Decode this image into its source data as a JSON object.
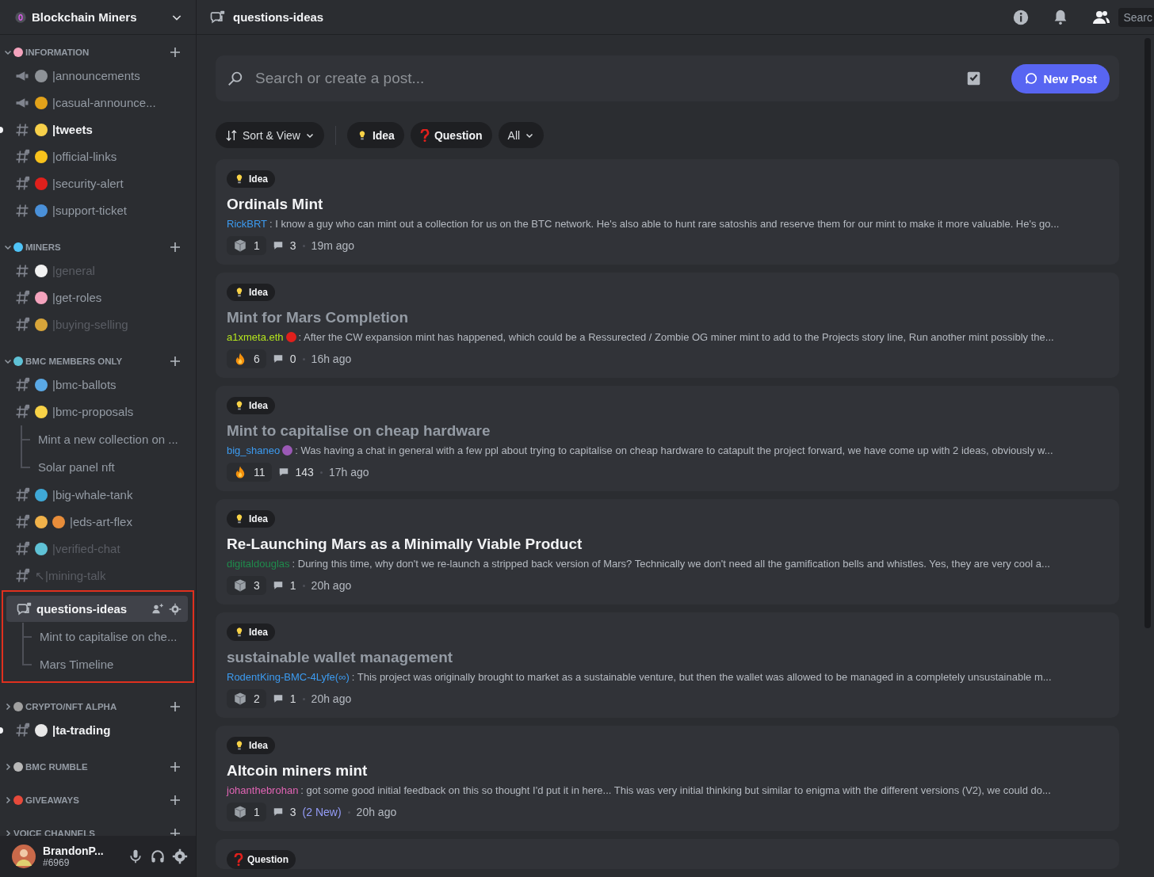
{
  "server": {
    "name": "Blockchain Miners"
  },
  "categories": [
    {
      "name": "INFORMATION",
      "emojis": [
        {
          "color": "#f4a3bd"
        }
      ],
      "expanded": true,
      "items": [
        {
          "kind": "announce",
          "emojis": [
            {
              "color": "#8e9297"
            }
          ],
          "label": "|announcements",
          "unread": false,
          "muted": false,
          "selected": false
        },
        {
          "kind": "announce",
          "emojis": [
            {
              "color": "#e2a21a"
            }
          ],
          "label": "|casual-announce...",
          "unread": false,
          "muted": false,
          "selected": false
        },
        {
          "kind": "text",
          "emojis": [
            {
              "color": "#f7d04a"
            }
          ],
          "label": "|tweets",
          "unread": true,
          "muted": false,
          "selected": false
        },
        {
          "kind": "text-locked",
          "emojis": [
            {
              "color": "#f8c21c"
            }
          ],
          "label": "|official-links",
          "unread": false,
          "muted": false,
          "selected": false
        },
        {
          "kind": "text-locked",
          "emojis": [
            {
              "color": "#e0201c"
            }
          ],
          "label": "|security-alert",
          "unread": false,
          "muted": false,
          "selected": false
        },
        {
          "kind": "text",
          "emojis": [
            {
              "color": "#4a90d9"
            }
          ],
          "label": "|support-ticket",
          "unread": false,
          "muted": false,
          "selected": false
        }
      ]
    },
    {
      "name": "MINERS",
      "emojis": [
        {
          "color": "#4fc3f7"
        }
      ],
      "expanded": true,
      "items": [
        {
          "kind": "text",
          "emojis": [
            {
              "color": "#f2f2f2"
            }
          ],
          "label": "|general",
          "unread": false,
          "muted": true,
          "selected": false
        },
        {
          "kind": "text-locked",
          "emojis": [
            {
              "color": "#f4a3bd"
            }
          ],
          "label": "|get-roles",
          "unread": false,
          "muted": false,
          "selected": false
        },
        {
          "kind": "text-locked",
          "emojis": [
            {
              "color": "#d8a53a"
            }
          ],
          "label": "|buying-selling",
          "unread": false,
          "muted": true,
          "selected": false
        }
      ]
    },
    {
      "name": "BMC MEMBERS ONLY",
      "emojis": [
        {
          "color": "#5fc2d6"
        }
      ],
      "expanded": true,
      "items": [
        {
          "kind": "text-locked",
          "emojis": [
            {
              "color": "#5aa9e6"
            }
          ],
          "label": "|bmc-ballots",
          "unread": false,
          "muted": false,
          "selected": false
        },
        {
          "kind": "thread-locked",
          "emojis": [
            {
              "color": "#f8d247"
            }
          ],
          "label": "|bmc-proposals",
          "unread": false,
          "muted": false,
          "selected": false,
          "children": [
            {
              "label": "Mint a new collection on ..."
            },
            {
              "label": "Solar panel nft"
            }
          ]
        },
        {
          "kind": "text-locked",
          "emojis": [
            {
              "color": "#3fa9d8"
            }
          ],
          "label": "|big-whale-tank",
          "unread": false,
          "muted": false,
          "selected": false
        },
        {
          "kind": "text-locked",
          "emojis": [
            {
              "color": "#f1b24a"
            },
            {
              "color": "#e88d3a"
            }
          ],
          "label": "|eds-art-flex",
          "unread": false,
          "muted": false,
          "selected": false
        },
        {
          "kind": "text-locked",
          "emojis": [
            {
              "color": "#5fc2d6"
            }
          ],
          "label": "|verified-chat",
          "unread": false,
          "muted": true,
          "selected": false
        },
        {
          "kind": "text-locked",
          "label": "↖|mining-talk",
          "unread": false,
          "muted": true,
          "selected": false
        },
        {
          "kind": "forum",
          "label": "questions-ideas",
          "unread": true,
          "muted": false,
          "selected": true,
          "framed": true,
          "children": [
            {
              "label": "Mint to capitalise on che..."
            },
            {
              "label": "Mars Timeline"
            }
          ]
        }
      ]
    },
    {
      "name": "CRYPTO/NFT ALPHA",
      "emojis": [
        {
          "color": "#a0a0a0"
        }
      ],
      "expanded": false,
      "items": [
        {
          "kind": "text-locked",
          "emojis": [
            {
              "color": "#e8e8e8"
            }
          ],
          "label": "|ta-trading",
          "unread": true,
          "muted": false,
          "selected": false
        }
      ]
    },
    {
      "name": "BMC RUMBLE",
      "emojis": [
        {
          "color": "#b8b8b8"
        }
      ],
      "expanded": false
    },
    {
      "name": "GIVEAWAYS",
      "emojis": [
        {
          "color": "#e64a3b"
        }
      ],
      "expanded": false
    },
    {
      "name": "VOICE CHANNELS",
      "expanded": false
    }
  ],
  "user": {
    "name": "BrandonP...",
    "tag": "#6969"
  },
  "header": {
    "title": "questions-ideas",
    "search": "Searc"
  },
  "search": {
    "placeholder": "Search or create a post..."
  },
  "new_post": "New Post",
  "filters": [
    {
      "kind": "sort",
      "label": "Sort & View"
    },
    {
      "kind": "idea",
      "label": "Idea"
    },
    {
      "kind": "question",
      "label": "Question"
    },
    {
      "kind": "all",
      "label": "All"
    }
  ],
  "posts": [
    {
      "tag": {
        "kind": "idea",
        "label": "Idea"
      },
      "title": "Ordinals Mint",
      "read": false,
      "author": "RickBRT",
      "color": "#3c9bf0",
      "snippet": ": I know a guy who can mint out a collection for us on the BTC network. He's also able to hunt rare satoshis and reserve them for our mint to make it more valuable. He's go...",
      "reaction": {
        "kind": "cube",
        "count": "1"
      },
      "comments": "3",
      "time": "19m ago"
    },
    {
      "tag": {
        "kind": "idea",
        "label": "Idea"
      },
      "title": "Mint for Mars Completion",
      "read": true,
      "author": "a1xmeta.eth",
      "color": "#b5e61d",
      "author_emojis": [
        {
          "color": "#e0201c"
        }
      ],
      "snippet": " : After the CW expansion mint has happened, which could be a Ressurected / Zombie OG miner mint to add to the Projects story line, Run another mint possibly the...",
      "reaction": {
        "kind": "fire",
        "count": "6"
      },
      "comments": "0",
      "time": "16h ago"
    },
    {
      "tag": {
        "kind": "idea",
        "label": "Idea"
      },
      "title": "Mint to capitalise on cheap hardware",
      "read": true,
      "author": "big_shaneo",
      "color": "#3c9bf0",
      "author_emojis": [
        {
          "color": "#9b59b6"
        }
      ],
      "snippet": " : Was having a chat in general with a few ppl about trying to capitalise on cheap hardware to catapult the project forward, we have come up with 2 ideas, obviously w...",
      "reaction": {
        "kind": "fire",
        "count": "11"
      },
      "comments": "143",
      "time": "17h ago"
    },
    {
      "tag": {
        "kind": "idea",
        "label": "Idea"
      },
      "title": "Re-Launching Mars as a Minimally Viable Product",
      "read": false,
      "author": "digitaldouglas",
      "color": "#1f8b4c",
      "snippet": ": During this time, why don't we re-launch a stripped back version of Mars? Technically we don't need all the gamification bells and whistles. Yes, they are very cool a...",
      "reaction": {
        "kind": "cube",
        "count": "3"
      },
      "comments": "1",
      "time": "20h ago"
    },
    {
      "tag": {
        "kind": "idea",
        "label": "Idea"
      },
      "title": "sustainable wallet management",
      "read": true,
      "author": "RodentKing-BMC-4Lyfe(∞)",
      "color": "#3c9bf0",
      "snippet": ": This project was originally brought to market as a sustainable venture, but then the wallet was allowed to be managed in a completely unsustainable m...",
      "reaction": {
        "kind": "cube",
        "count": "2"
      },
      "comments": "1",
      "time": "20h ago"
    },
    {
      "tag": {
        "kind": "idea",
        "label": "Idea"
      },
      "title": "Altcoin miners mint",
      "read": false,
      "author": "johanthebrohan",
      "color": "#e164b4",
      "snippet": ": got some good initial feedback on this so thought I'd put it in here... This was very initial thinking but similar to enigma with the different versions (V2), we could do...",
      "reaction": {
        "kind": "cube",
        "count": "1"
      },
      "comments": "3",
      "new": "(2 New)",
      "time": "20h ago"
    },
    {
      "tag": {
        "kind": "question",
        "label": "Question"
      },
      "partial": true
    }
  ]
}
